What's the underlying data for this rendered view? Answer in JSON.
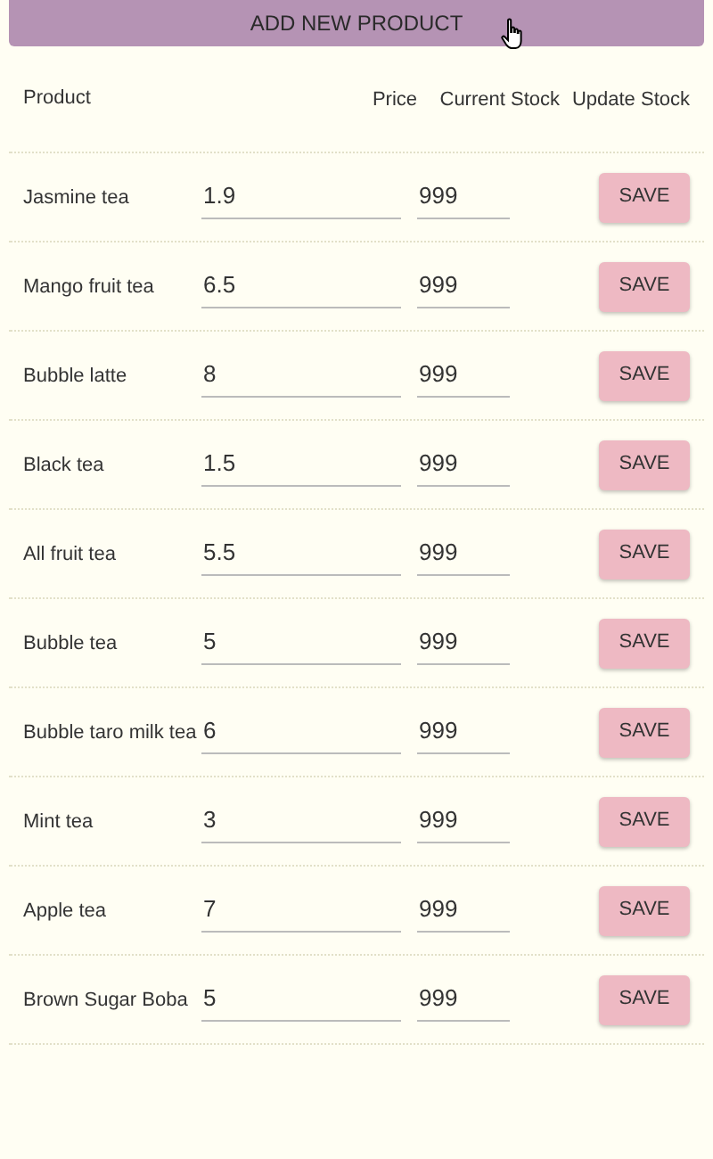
{
  "add_button": {
    "label": "ADD NEW PRODUCT"
  },
  "columns": [
    "Product",
    "Price",
    "Current Stock",
    "Update Stock"
  ],
  "rows": [
    {
      "product": "Jasmine tea",
      "price": "1.9",
      "stock": "999",
      "action": "SAVE"
    },
    {
      "product": "Mango fruit tea",
      "price": "6.5",
      "stock": "999",
      "action": "SAVE"
    },
    {
      "product": "Bubble latte",
      "price": "8",
      "stock": "999",
      "action": "SAVE"
    },
    {
      "product": "Black tea",
      "price": "1.5",
      "stock": "999",
      "action": "SAVE"
    },
    {
      "product": "All fruit tea",
      "price": "5.5",
      "stock": "999",
      "action": "SAVE"
    },
    {
      "product": "Bubble tea",
      "price": "5",
      "stock": "999",
      "action": "SAVE"
    },
    {
      "product": "Bubble taro milk tea",
      "price": "6",
      "stock": "999",
      "action": "SAVE"
    },
    {
      "product": "Mint tea",
      "price": "3",
      "stock": "999",
      "action": "SAVE"
    },
    {
      "product": "Apple tea",
      "price": "7",
      "stock": "999",
      "action": "SAVE"
    },
    {
      "product": "Brown Sugar Boba",
      "price": "5",
      "stock": "999",
      "action": "SAVE"
    }
  ]
}
